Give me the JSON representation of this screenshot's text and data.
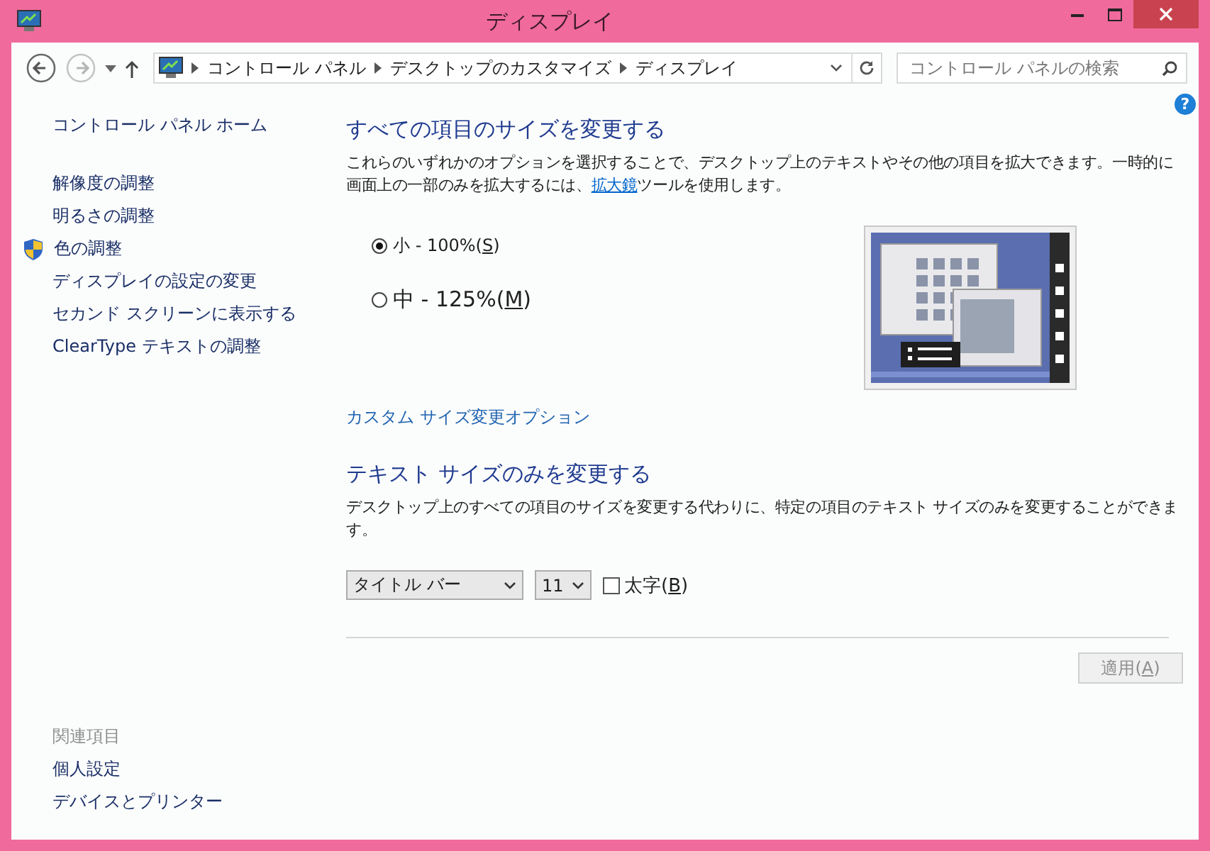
{
  "window": {
    "title": "ディスプレイ"
  },
  "nav": [
    {
      "kind": "back",
      "disabled": false
    },
    {
      "kind": "forward",
      "disabled": true
    }
  ],
  "address_bar": {
    "path": [
      "コントロール パネル",
      "デスクトップのカスタマイズ",
      "ディスプレイ"
    ]
  },
  "search": {
    "placeholder": "コントロール パネルの検索"
  },
  "sidebar": {
    "home": "コントロール パネル ホーム",
    "tasks": [
      {
        "label": "解像度の調整",
        "shield": false
      },
      {
        "label": "明るさの調整",
        "shield": false
      },
      {
        "label": "色の調整",
        "shield": true
      },
      {
        "label": "ディスプレイの設定の変更",
        "shield": false
      },
      {
        "label": "セカンド スクリーンに表示する",
        "shield": false
      },
      {
        "label": "ClearType テキストの調整",
        "shield": false
      }
    ],
    "see_also": {
      "heading": "関連項目",
      "links": [
        "個人設定",
        "デバイスとプリンター"
      ]
    }
  },
  "help": "?",
  "scale_section": {
    "heading": "すべての項目のサイズを変更する",
    "description": {
      "before": "これらのいずれかのオプションを選択することで、デスクトップ上のテキストやその他の項目を拡大できます。一時的に画面上の一部のみを拡大するには、",
      "link": "拡大鏡",
      "after": "ツールを使用します。"
    },
    "options": [
      {
        "kind": "small",
        "label": "小 - 100%(",
        "key": "S",
        "end": ")",
        "selected": true
      },
      {
        "kind": "medium",
        "label": "中 - 125%(",
        "key": "M",
        "end": ")",
        "selected": false
      }
    ],
    "custom_link": "カスタム サイズ変更オプション"
  },
  "text_section": {
    "heading": "テキスト サイズのみを変更する",
    "description": "デスクトップ上のすべての項目のサイズを変更する代わりに、特定の項目のテキスト サイズのみを変更することができます。",
    "item_select": {
      "value": "タイトル バー"
    },
    "size_select": {
      "value": "11"
    },
    "bold": {
      "label": "太字(",
      "key": "B",
      "end": ")",
      "checked": false
    }
  },
  "apply": {
    "label": "適用(",
    "key": "A",
    "end": ")",
    "disabled": true
  }
}
